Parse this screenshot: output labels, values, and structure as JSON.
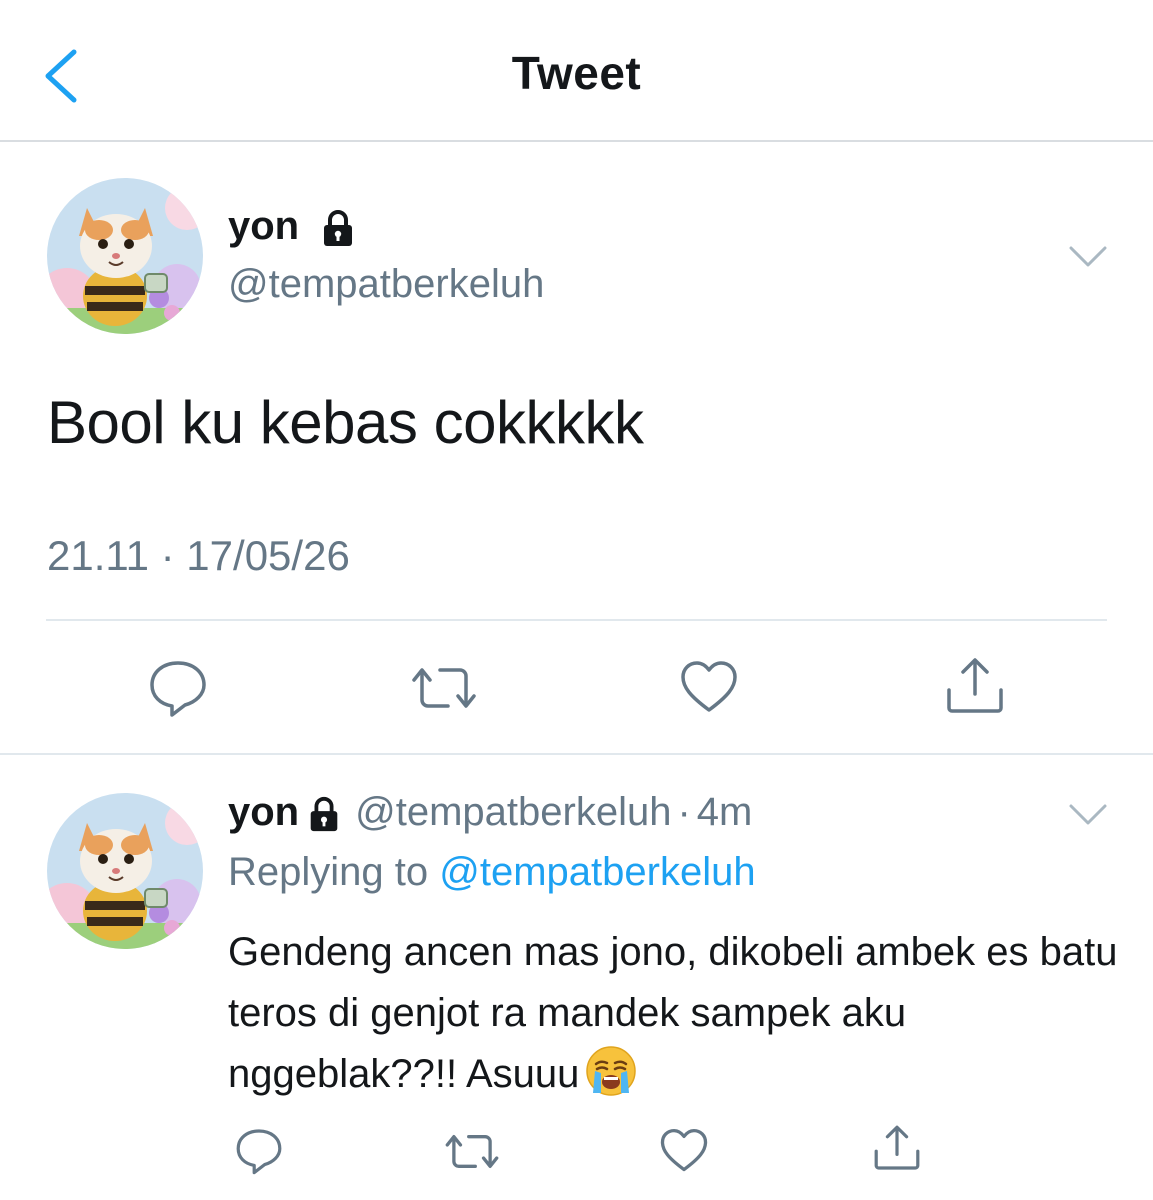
{
  "header": {
    "title": "Tweet"
  },
  "main_tweet": {
    "display_name": "yon",
    "handle": "@tempatberkeluh",
    "text": "Bool ku kebas cokkkkk",
    "timestamp": "21.11 · 17/05/26",
    "avatar_icon": "cat-in-bee-costume-avatar"
  },
  "reply": {
    "display_name": "yon",
    "handle": "@tempatberkeluh",
    "separator": "·",
    "time": "4m",
    "replying_prefix": "Replying to",
    "replying_handle": "@tempatberkeluh",
    "text": "Gendeng ancen mas jono, dikobeli ambek es batu teros di genjot ra mandek sampek aku nggeblak??!! Asuuu",
    "emoji": "loudly-crying-face-emoji"
  },
  "colors": {
    "accent": "#1da1f2",
    "text": "#14171a",
    "secondary": "#657786",
    "divider": "#e1e8ed"
  },
  "icons": [
    "back-chevron-icon",
    "lock-icon",
    "chevron-down-icon",
    "reply-icon",
    "retweet-icon",
    "like-icon",
    "share-icon"
  ]
}
